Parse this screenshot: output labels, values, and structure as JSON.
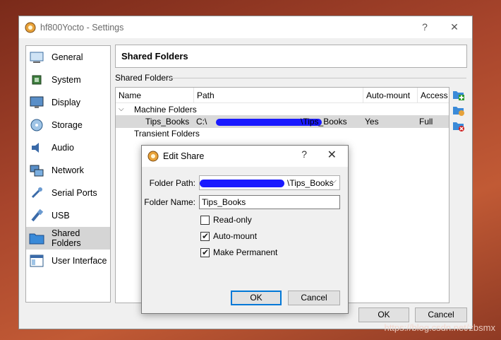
{
  "window": {
    "title": "hf800Yocto - Settings",
    "help_glyph": "?",
    "close_glyph": "✕"
  },
  "sidebar": {
    "items": [
      {
        "label": "General",
        "icon": "general-icon"
      },
      {
        "label": "System",
        "icon": "system-chip-icon"
      },
      {
        "label": "Display",
        "icon": "display-monitor-icon"
      },
      {
        "label": "Storage",
        "icon": "storage-disk-icon"
      },
      {
        "label": "Audio",
        "icon": "audio-speaker-icon"
      },
      {
        "label": "Network",
        "icon": "network-icon"
      },
      {
        "label": "Serial Ports",
        "icon": "serial-port-icon"
      },
      {
        "label": "USB",
        "icon": "usb-icon"
      },
      {
        "label": "Shared Folders",
        "icon": "shared-folder-icon",
        "selected": true
      },
      {
        "label": "User Interface",
        "icon": "user-interface-icon"
      }
    ]
  },
  "page": {
    "header": "Shared Folders",
    "group_label": "Shared Folders"
  },
  "table": {
    "columns": [
      "Name",
      "Path",
      "Auto-mount",
      "Access"
    ],
    "machine_folders": "Machine Folders",
    "transient_folders": "Transient Folders",
    "row": {
      "name": "Tips_Books",
      "path_prefix": "C:\\",
      "path_suffix": "\\Tips_Books",
      "auto_mount": "Yes",
      "access": "Full"
    }
  },
  "tools": [
    "add-share-icon",
    "edit-share-icon",
    "remove-share-icon"
  ],
  "buttons": {
    "ok": "OK",
    "cancel": "Cancel"
  },
  "dialog": {
    "title": "Edit Share",
    "help_glyph": "?",
    "close_glyph": "✕",
    "folder_path_label": "Folder Path:",
    "folder_path_value": "\\Tips_Books",
    "folder_name_label": "Folder Name:",
    "folder_name_value": "Tips_Books",
    "read_only_label": "Read-only",
    "read_only_checked": false,
    "auto_mount_label": "Auto-mount",
    "auto_mount_checked": true,
    "make_permanent_label": "Make Permanent",
    "make_permanent_checked": true,
    "ok": "OK",
    "cancel": "Cancel"
  },
  "watermark": "https://blog.csdn.net/zbsmx",
  "colors": {
    "redaction": "#1a1aff",
    "selection": "#d9d9d9",
    "default_button_border": "#0078d7"
  }
}
